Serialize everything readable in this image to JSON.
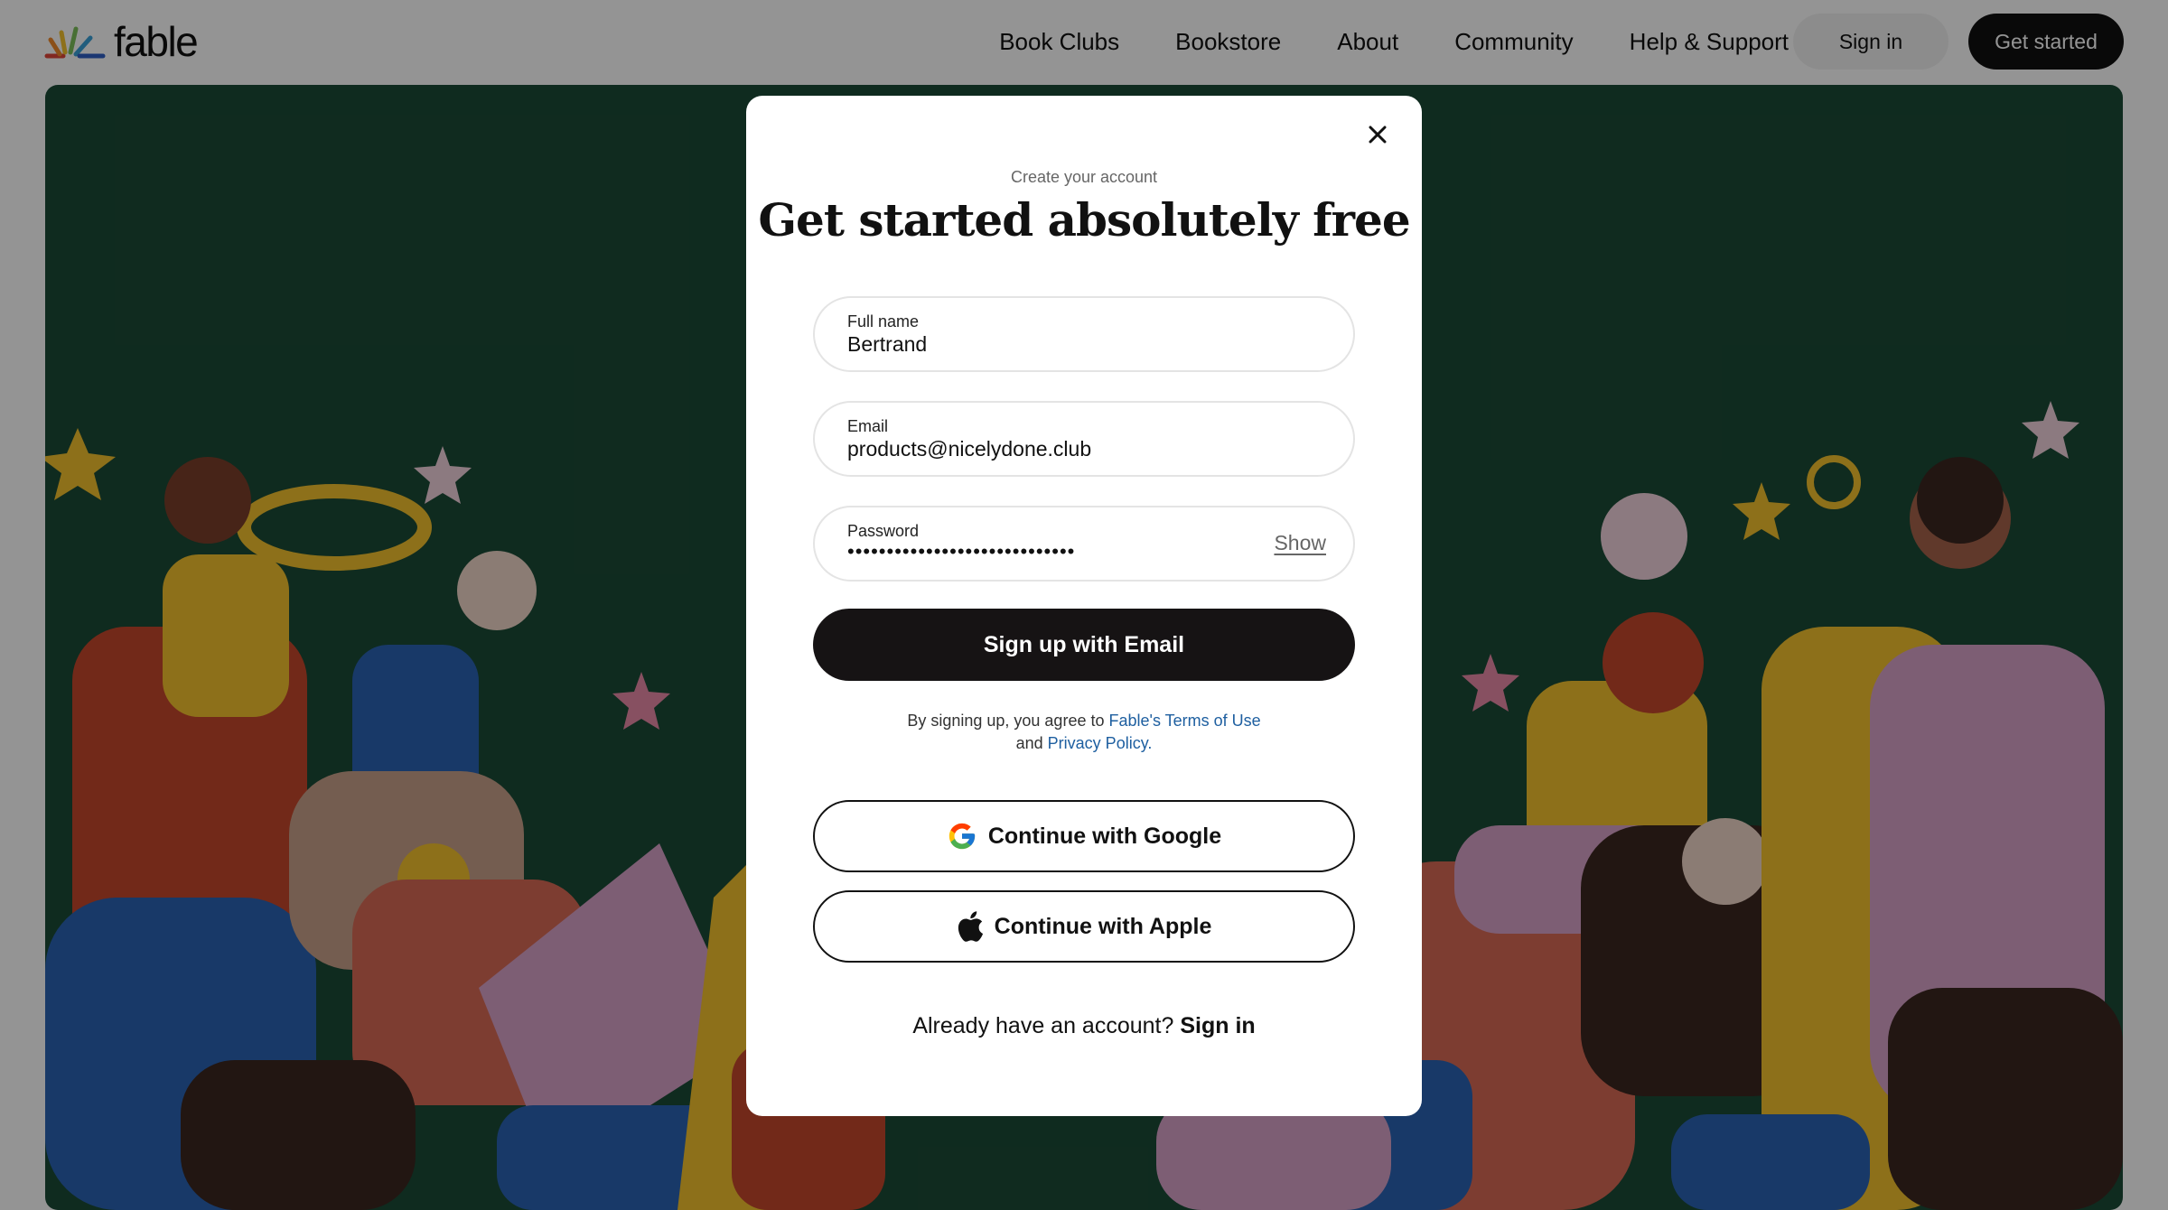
{
  "brand": {
    "name": "fable"
  },
  "nav": {
    "items": [
      "Book Clubs",
      "Bookstore",
      "About",
      "Community",
      "Help & Support"
    ],
    "sign_in": "Sign in",
    "get_started": "Get started"
  },
  "modal": {
    "eyebrow": "Create your account",
    "title": "Get started absolutely free",
    "full_name": {
      "label": "Full name",
      "value": "Bertrand"
    },
    "email": {
      "label": "Email",
      "value": "products@nicelydone.club"
    },
    "password": {
      "label": "Password",
      "value": "•••••••••••••••••••••••••••••",
      "show_label": "Show"
    },
    "signup_button": "Sign up with Email",
    "terms": {
      "prefix": "By signing up, you agree to ",
      "terms_link": "Fable's Terms of Use",
      "middle": " and ",
      "privacy_link": "Privacy Policy."
    },
    "google_button": "Continue with Google",
    "apple_button": "Continue with Apple",
    "footer": {
      "prompt": "Already have an account? ",
      "sign_in": "Sign in"
    }
  },
  "colors": {
    "hero_bg": "#1b4a36",
    "primary_button": "#161314",
    "link": "#1e5fa0"
  },
  "icons": [
    "close-icon",
    "google-icon",
    "apple-icon",
    "fable-logo-icon"
  ]
}
